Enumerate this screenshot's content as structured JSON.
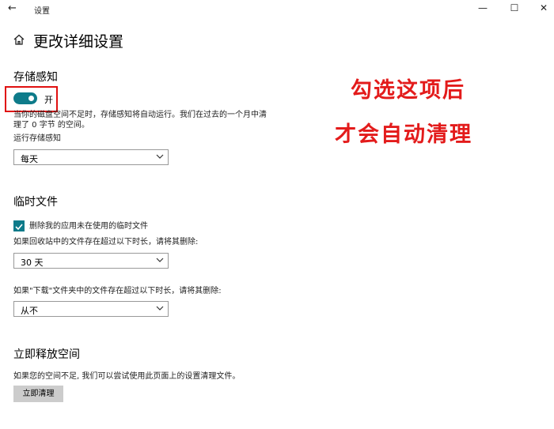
{
  "window": {
    "title": "设置",
    "back_icon": "back-arrow-icon",
    "minimize_glyph": "—",
    "maximize_glyph": "☐",
    "close_glyph": "✕"
  },
  "page": {
    "title": "更改详细设置"
  },
  "storage_sense": {
    "heading": "存储感知",
    "toggle_state": "开",
    "toggle_on": true,
    "description_line1": "当你的磁盘空间不足时，存储感知将自动运行。我们在过去的一个月中清",
    "description_line2": "理了 0 字节 的空间。",
    "run_label": "运行存储感知",
    "run_value": "每天"
  },
  "temp_files": {
    "heading": "临时文件",
    "checkbox_label": "删除我的应用未在使用的临时文件",
    "checkbox_checked": true,
    "recycle_label": "如果回收站中的文件存在超过以下时长，请将其删除:",
    "recycle_value": "30 天",
    "downloads_label": "如果\"下载\"文件夹中的文件存在超过以下时长，请将其删除:",
    "downloads_value": "从不"
  },
  "free_space": {
    "heading": "立即释放空间",
    "description": "如果您的空间不足, 我们可以尝试使用此页面上的设置清理文件。",
    "button_label": "立即清理"
  },
  "annotation": {
    "line1": "勾选这项后",
    "line2": "才会自动清理"
  },
  "colors": {
    "accent": "#0e7b8a",
    "annotation_red": "#e31b1b"
  }
}
